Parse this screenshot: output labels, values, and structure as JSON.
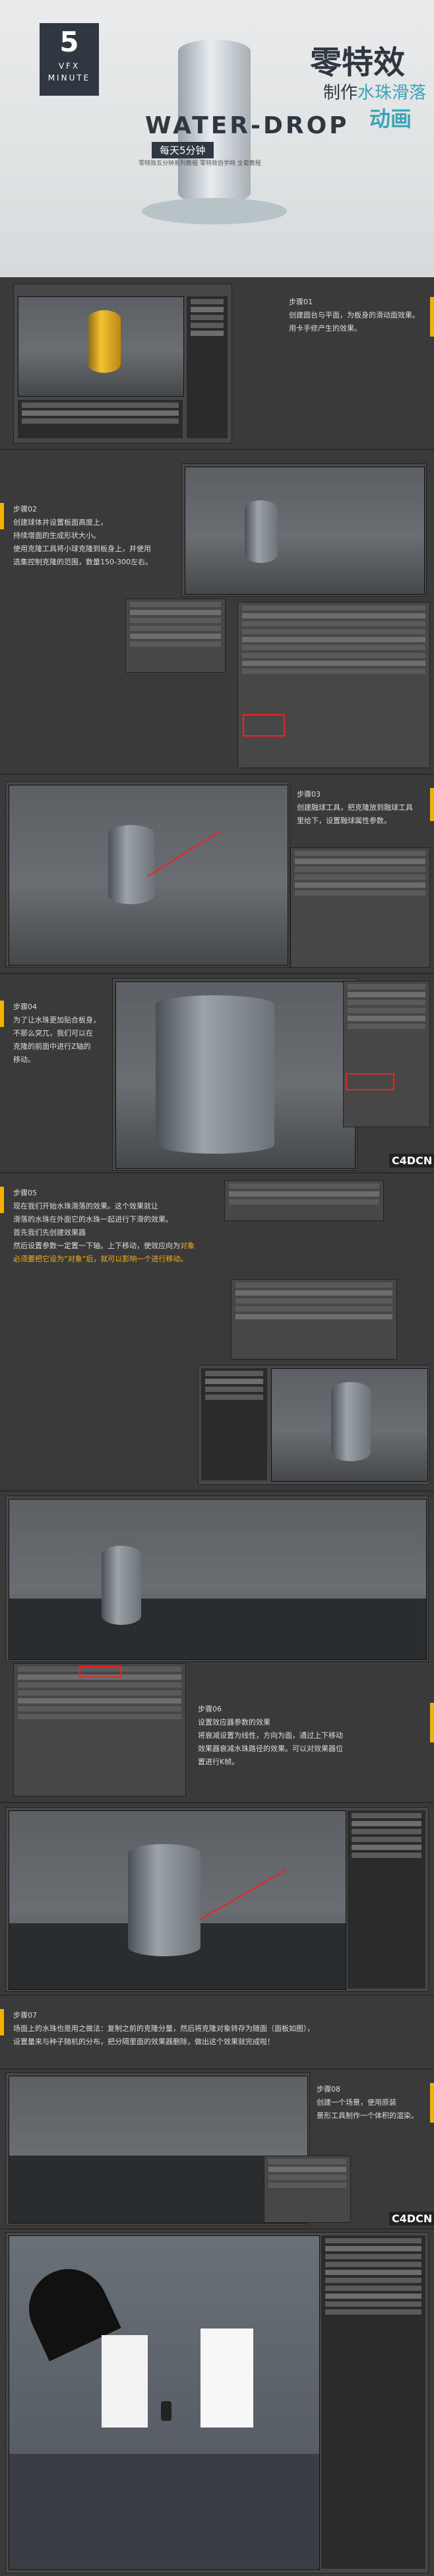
{
  "hero": {
    "logo_num": "5",
    "logo_l2": "VFX",
    "logo_l3": "MINUTE",
    "title": "零特效",
    "sub1_a": "制作",
    "sub1_b": "水珠滑落",
    "sub2": "动画",
    "wd": "WATER-DROP",
    "wd_sub": "每天5分钟",
    "wd_sub2": "零特效五分钟系列教程 零特效自学网 全套教程"
  },
  "step01": {
    "head": "步骤01",
    "l1": "创建圆台与平面，为板身的滑动面效果。",
    "l2": "用卡手修产生的效果。"
  },
  "step02": {
    "head": "步骤02",
    "l1": "创建球体并设置板面高度上，",
    "l2": "持续增面的生成形状大小。",
    "l3": "使用克隆工具将小球克隆到板身上，并使用",
    "l4": "选集控制克隆的范围，数量150-300左右。"
  },
  "step03": {
    "head": "步骤03",
    "l1": "创建融球工具，把克隆放到融球工具",
    "l2": "里给下，设置融球属性参数。"
  },
  "step04": {
    "head": "步骤04",
    "l1": "为了让水珠更加贴合板身，",
    "l2": "不那么突兀，我们可以在",
    "l3": "克隆的前面中进行Z轴的",
    "l4": "移动。"
  },
  "step05": {
    "head": "步骤05",
    "l1": "现在我们开始水珠滑落的效果。这个效果就让",
    "l2": "滑落的水珠在外面它的水珠一起进行下滑的效果。",
    "l3": "首先我们先创建效果器",
    "l4": "然后设置参数一定置一下轴。上下移动，使效应向为",
    "l4_hl": "对象",
    "l5": "必须要把它设为“对象”后，就可以影响一个进行移动。"
  },
  "step06": {
    "head": "步骤06",
    "l1": "设置效应器参数的效果",
    "l2": "将衰减设置为线性，方向为面，通过上下移动",
    "l3": "效果器衰减水珠路径的效果。可以对效果器位",
    "l4": "置进行K帧。"
  },
  "step07": {
    "head": "步骤07",
    "l1": "场面上的水珠也是用之做法：复制之前的克隆分量，然后将克隆对象转存为随面（面板如图），",
    "l2": "设置量来与种子随机的分布，把分隔里面的效果器删除，做出这个效果就完成啦！"
  },
  "step08": {
    "head": "步骤08",
    "l1": "创建一个场景，使用原装",
    "l2": "景形工具制作一个体积的渲染。"
  },
  "watermarks": {
    "a": "C4DCN",
    "b": "C4DCN"
  },
  "colors": {
    "accent": "#f0b400",
    "teal": "#3aa4b8",
    "dark": "#2f3840",
    "arrow": "#e22222"
  }
}
